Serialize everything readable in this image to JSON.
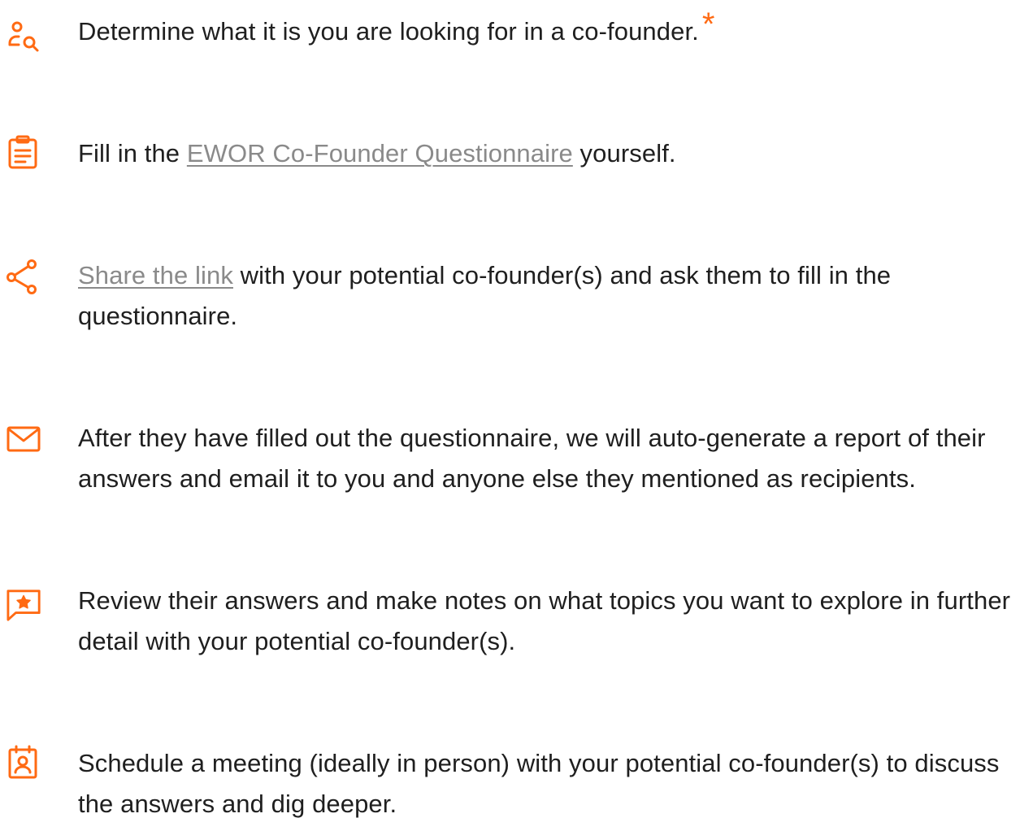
{
  "accent_color": "#ff6a13",
  "link_color": "#8a8a8a",
  "steps": [
    {
      "icon": "user-search-icon",
      "text": "Determine what it is you are looking for in a co-founder.",
      "marker": "*"
    },
    {
      "icon": "clipboard-icon",
      "before": "Fill in the ",
      "link": "EWOR Co-Founder Questionnaire",
      "after": " yourself."
    },
    {
      "icon": "share-icon",
      "link": "Share the link",
      "after": " with your potential co-founder(s) and ask them to fill in the questionnaire."
    },
    {
      "icon": "mail-icon",
      "text": "After they have filled out the questionnaire, we will auto-generate a report of their answers and email it to you and anyone else they mentioned as recipients."
    },
    {
      "icon": "star-message-icon",
      "text": "Review their answers and make notes on what topics you want to explore in further detail with your potential co-founder(s)."
    },
    {
      "icon": "calendar-user-icon",
      "text": "Schedule a meeting (ideally in person) with your potential co-founder(s) to discuss the answers and dig deeper."
    }
  ]
}
